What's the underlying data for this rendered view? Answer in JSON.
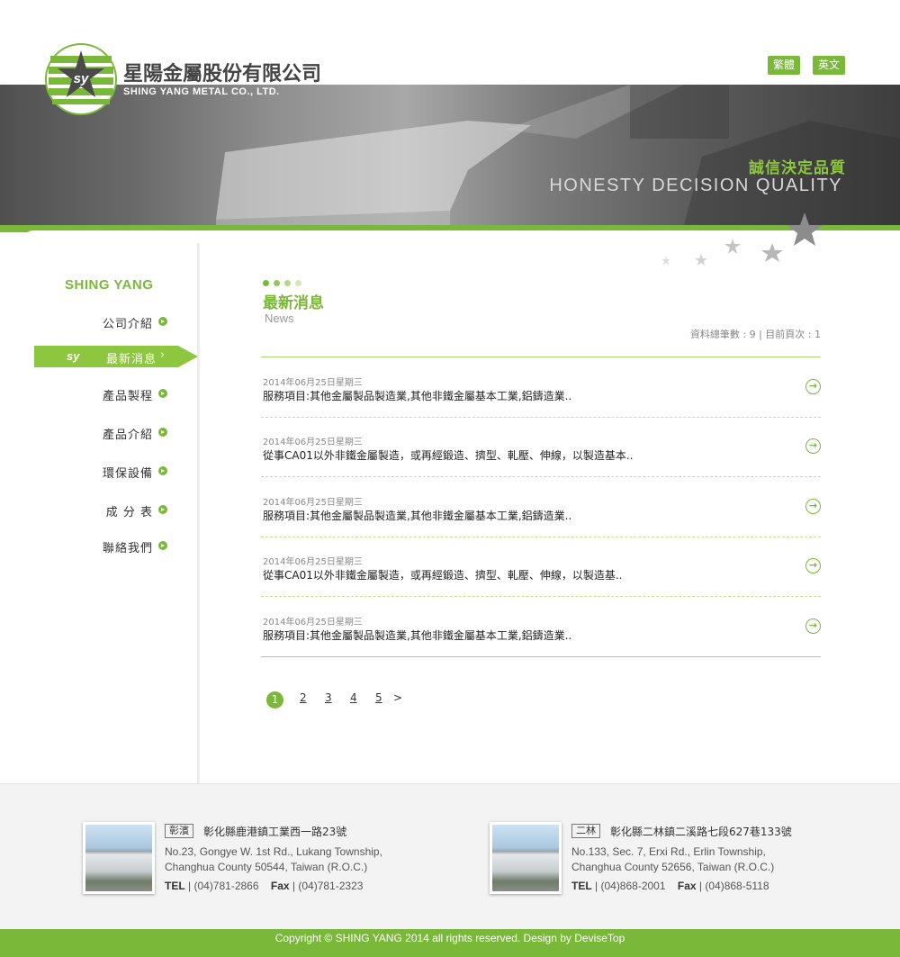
{
  "header": {
    "brand_cn": "星陽金屬股份有限公司",
    "brand_en": "SHING YANG METAL CO., LTD.",
    "lang_tw": "繁體",
    "lang_en": "英文",
    "slogan_cn": "誠信決定品質",
    "slogan_en": "HONESTY DECISION QUALITY",
    "accent_color": "#7ab83a"
  },
  "sidebar": {
    "title": "SHING YANG",
    "active_badge": "sy",
    "items": [
      {
        "label": "公司介紹"
      },
      {
        "label": "最新消息"
      },
      {
        "label": "產品製程"
      },
      {
        "label": "產品介紹"
      },
      {
        "label": "環保設備"
      },
      {
        "label": "成 分 表"
      },
      {
        "label": "聯絡我們"
      }
    ]
  },
  "main": {
    "title": "最新消息",
    "subtitle": "News",
    "record_info": "資料總筆數 : 9 | 目前頁次 : 1",
    "news": [
      {
        "date": "2014年06月25日星期三",
        "text": "服務項目:其他金屬製品製造業,其他非鐵金屬基本工業,鋁鑄造業.."
      },
      {
        "date": "2014年06月25日星期三",
        "text": "從事CA01以外非鐵金屬製造，或再經鍛造、擠型、軋壓、伸線，以製造基本.."
      },
      {
        "date": "2014年06月25日星期三",
        "text": "服務項目:其他金屬製品製造業,其他非鐵金屬基本工業,鋁鑄造業.."
      },
      {
        "date": "2014年06月25日星期三",
        "text": "從事CA01以外非鐵金屬製造，或再經鍛造、擠型、軋壓、伸線，以製造基.."
      },
      {
        "date": "2014年06月25日星期三",
        "text": "服務項目:其他金屬製品製造業,其他非鐵金屬基本工業,鋁鑄造業.."
      }
    ],
    "pagination": {
      "pages": [
        "1",
        "2",
        "3",
        "4",
        "5"
      ],
      "current": "1",
      "next": ">"
    }
  },
  "footer": {
    "offices": [
      {
        "tag": "彰濱",
        "addr_cn": "彰化縣鹿港鎮工業西一路23號",
        "addr_en1": "No.23, Gongye W. 1st Rd., Lukang Township,",
        "addr_en2": "Changhua County 50544, Taiwan (R.O.C.)",
        "tel_label": "TEL",
        "tel": "(04)781-2866",
        "fax_label": "Fax",
        "fax": "(04)781-2323"
      },
      {
        "tag": "二林",
        "addr_cn": "彰化縣二林鎮二溪路七段627巷133號",
        "addr_en1": "No.133, Sec. 7, Erxi Rd., Erlin Township,",
        "addr_en2": "Changhua County 52656, Taiwan (R.O.C.)",
        "tel_label": "TEL",
        "tel": "(04)868-2001",
        "fax_label": "Fax",
        "fax": "(04)868-5118"
      }
    ],
    "copyright": "Copyright © SHING YANG 2014 all rights reserved. Design by DeviseTop"
  }
}
